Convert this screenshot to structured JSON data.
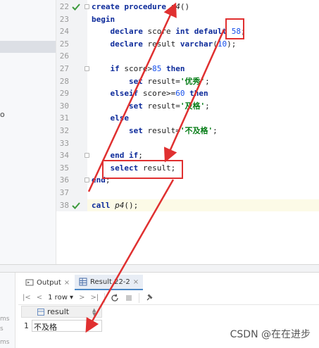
{
  "left_strip": {
    "fragment": "o"
  },
  "editor": {
    "lines": [
      {
        "num": "22",
        "tokens": [
          [
            "kw",
            "create procedure "
          ],
          [
            "fn",
            "p4"
          ],
          [
            "txt",
            "()"
          ]
        ],
        "check": true
      },
      {
        "num": "23",
        "tokens": [
          [
            "kw",
            "begin"
          ]
        ]
      },
      {
        "num": "24",
        "tokens": [
          [
            "txt",
            "    "
          ],
          [
            "kw",
            "declare "
          ],
          [
            "txt",
            "score "
          ],
          [
            "kw",
            "int default "
          ],
          [
            "num",
            "58"
          ],
          [
            "txt",
            ";"
          ]
        ]
      },
      {
        "num": "25",
        "tokens": [
          [
            "txt",
            "    "
          ],
          [
            "kw",
            "declare "
          ],
          [
            "txt",
            "result "
          ],
          [
            "kw",
            "varchar"
          ],
          [
            "txt",
            "("
          ],
          [
            "num",
            "10"
          ],
          [
            "txt",
            ");"
          ]
        ]
      },
      {
        "num": "26",
        "tokens": []
      },
      {
        "num": "27",
        "tokens": [
          [
            "txt",
            "    "
          ],
          [
            "kw",
            "if "
          ],
          [
            "txt",
            "score>"
          ],
          [
            "num",
            "85 "
          ],
          [
            "kw",
            "then"
          ]
        ]
      },
      {
        "num": "28",
        "tokens": [
          [
            "txt",
            "        "
          ],
          [
            "kw",
            "set "
          ],
          [
            "txt",
            "result="
          ],
          [
            "str",
            "'优秀'"
          ],
          [
            "txt",
            ";"
          ]
        ]
      },
      {
        "num": "29",
        "tokens": [
          [
            "txt",
            "    "
          ],
          [
            "kw",
            "elseif "
          ],
          [
            "txt",
            "score>="
          ],
          [
            "num",
            "60 "
          ],
          [
            "kw",
            "then"
          ]
        ]
      },
      {
        "num": "30",
        "tokens": [
          [
            "txt",
            "        "
          ],
          [
            "kw",
            "set "
          ],
          [
            "txt",
            "result="
          ],
          [
            "str",
            "'及格'"
          ],
          [
            "txt",
            ";"
          ]
        ]
      },
      {
        "num": "31",
        "tokens": [
          [
            "txt",
            "    "
          ],
          [
            "kw",
            "else"
          ]
        ]
      },
      {
        "num": "32",
        "tokens": [
          [
            "txt",
            "        "
          ],
          [
            "kw",
            "set "
          ],
          [
            "txt",
            "result="
          ],
          [
            "str",
            "'不及格'"
          ],
          [
            "txt",
            ";"
          ]
        ]
      },
      {
        "num": "33",
        "tokens": []
      },
      {
        "num": "34",
        "tokens": [
          [
            "txt",
            "    "
          ],
          [
            "kw",
            "end if"
          ],
          [
            "txt",
            ";"
          ]
        ]
      },
      {
        "num": "35",
        "tokens": [
          [
            "txt",
            "    "
          ],
          [
            "kw",
            "select "
          ],
          [
            "txt",
            "result;"
          ]
        ]
      },
      {
        "num": "36",
        "tokens": [
          [
            "kw",
            "end"
          ],
          [
            "txt",
            ";"
          ]
        ]
      },
      {
        "num": "37",
        "tokens": []
      },
      {
        "num": "38",
        "tokens": [
          [
            "kw",
            "call "
          ],
          [
            "fn",
            "p4"
          ],
          [
            "txt",
            "();"
          ]
        ],
        "check": true
      }
    ]
  },
  "services": {
    "side_labels": [
      "ms",
      "s",
      "ms"
    ],
    "tabs": [
      {
        "label": "Output",
        "close": "×"
      },
      {
        "label": "Result 22-2",
        "close": "×"
      }
    ],
    "toolbar": {
      "first": "|<",
      "prev": "<",
      "rows": "1 row",
      "next": ">",
      "last": ">|",
      "refresh_icon": "refresh-icon",
      "stop_icon": "stop-icon",
      "pin_icon": "pin-icon"
    },
    "grid": {
      "columns": [
        "result"
      ],
      "rows": [
        {
          "num": "1",
          "values": [
            "不及格"
          ]
        }
      ]
    }
  },
  "watermark": "CSDN @在在进步",
  "colors": {
    "keyword": "#0c2a9a",
    "number": "#1750eb",
    "string": "#067d17",
    "annotation": "#e03030",
    "check": "#3c9a3c"
  }
}
